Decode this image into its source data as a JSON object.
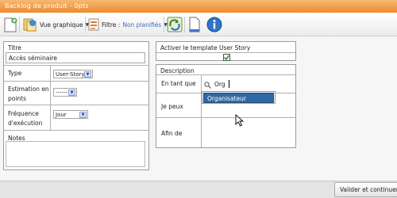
{
  "window": {
    "title": "Backlog de produit - 0pts"
  },
  "toolbar": {
    "view_label": "Vue graphique",
    "filter_label": "Filtre :",
    "filter_value": "Non planifiés"
  },
  "left": {
    "titre_label": "Titre",
    "titre_value": "Accès séminaire",
    "type_label": "Type",
    "type_value": "User-Story",
    "estimation_label_1": "Estimation en",
    "estimation_label_2": "points",
    "estimation_value": "------",
    "frequence_label_1": "Fréquence",
    "frequence_label_2": "d'exécution",
    "frequence_value": "Jour",
    "notes_label": "Notes"
  },
  "right": {
    "template_label": "Activer le template User Story",
    "template_checked": true,
    "description_label": "Description",
    "en_tant_que_label": "En tant que",
    "en_tant_que_value": "Org",
    "je_peux_label": "Je peux",
    "afin_de_label": "Afin de",
    "suggestion": "Organisateur"
  },
  "footer": {
    "submit_label": "Valider et continuer"
  },
  "colors": {
    "titlebar": "#ec8a2f",
    "accent_blue": "#2f6aa6"
  }
}
